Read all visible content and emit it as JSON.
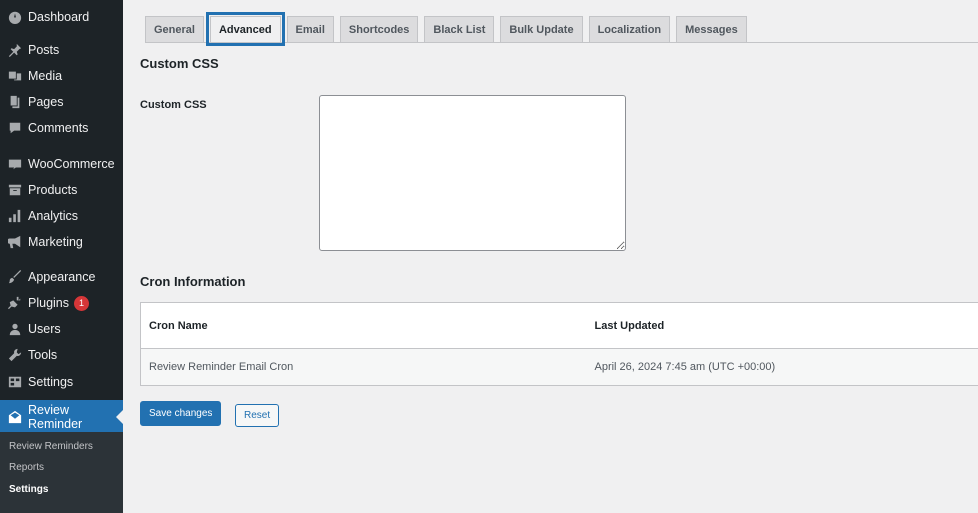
{
  "sidebar": {
    "items": [
      {
        "label": "Dashboard",
        "icon": "dashboard-icon"
      },
      {
        "label": "Posts",
        "icon": "pin-icon"
      },
      {
        "label": "Media",
        "icon": "media-icon"
      },
      {
        "label": "Pages",
        "icon": "pages-icon"
      },
      {
        "label": "Comments",
        "icon": "comment-icon"
      },
      {
        "label": "WooCommerce",
        "icon": "woocommerce-icon"
      },
      {
        "label": "Products",
        "icon": "archive-icon"
      },
      {
        "label": "Analytics",
        "icon": "bar-chart-icon"
      },
      {
        "label": "Marketing",
        "icon": "megaphone-icon"
      },
      {
        "label": "Appearance",
        "icon": "brush-icon"
      },
      {
        "label": "Plugins",
        "icon": "plugin-icon",
        "badge": "1"
      },
      {
        "label": "Users",
        "icon": "user-icon"
      },
      {
        "label": "Tools",
        "icon": "wrench-icon"
      },
      {
        "label": "Settings",
        "icon": "settings-icon"
      },
      {
        "label": "Review Reminder",
        "icon": "envelope-icon",
        "current": true
      }
    ],
    "submenu": [
      "Review Reminders",
      "Reports",
      "Settings"
    ],
    "submenu_active": "Settings"
  },
  "tabs": [
    "General",
    "Advanced",
    "Email",
    "Shortcodes",
    "Black List",
    "Bulk Update",
    "Localization",
    "Messages"
  ],
  "active_tab": "Advanced",
  "custom_css": {
    "section_title": "Custom CSS",
    "field_label": "Custom CSS",
    "value": ""
  },
  "cron": {
    "section_title": "Cron Information",
    "headers": [
      "Cron Name",
      "Last Updated"
    ],
    "rows": [
      [
        "Review Reminder Email Cron",
        "April 26, 2024 7:45 am (UTC +00:00)"
      ]
    ]
  },
  "buttons": {
    "save": "Save changes",
    "reset": "Reset"
  },
  "colors": {
    "accent": "#2271b1",
    "sidebar_bg": "#1d2327",
    "badge": "#d63638"
  }
}
